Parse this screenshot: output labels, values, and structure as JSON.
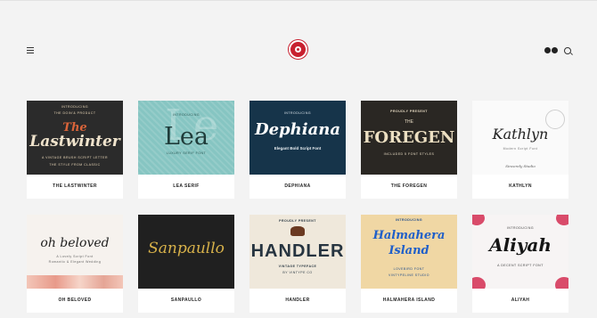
{
  "header": {
    "menu_icon": "hamburger-menu-icon",
    "logo": "brand-logo",
    "social_icons": [
      "dribbble-icon",
      "behance-icon"
    ],
    "search_icon": "search-icon"
  },
  "colors": {
    "background": "#f3f3f3",
    "card": "#ffffff",
    "logo": "#c8202f",
    "text": "#222222"
  },
  "products": [
    {
      "label": "THE LASTWINTER",
      "thumb": {
        "line1": "INTRODUCING",
        "line2": "THE DOIN'& PRODUCT",
        "line3": "A VINTAGE BRUSH SCRIPT LETTER",
        "title1": "The",
        "title2": "Lastwinter",
        "footer": "THE STYLE FROM CLASSIC"
      }
    },
    {
      "label": "LEA SERIF",
      "thumb": {
        "line1": "INTRODUCING",
        "title": "Lea",
        "footer": "LUXURY SERIF FONT"
      }
    },
    {
      "label": "DEPHIANA",
      "thumb": {
        "line1": "INTRODUCING",
        "title": "Dephiana",
        "subtitle": "Elegant Bold Script Font"
      }
    },
    {
      "label": "THE FOREGEN",
      "thumb": {
        "line1": "PROUDLY PRESENT",
        "line2": "THE",
        "title": "FOREGEN",
        "subtitle": "INCLUDED 5 FONT STYLES"
      }
    },
    {
      "label": "KATHLYN",
      "thumb": {
        "title": "Kathlyn",
        "footer": "Modern Script Font",
        "signature": "Sincerely Studio"
      }
    },
    {
      "label": "OH BELOVED",
      "thumb": {
        "title": "oh beloved",
        "subtitle": "A Lovely Script Font",
        "footer": "Romantic & Elegant Wedding"
      }
    },
    {
      "label": "SANPAULLO",
      "thumb": {
        "title": "Sanpaullo"
      }
    },
    {
      "label": "HANDLER",
      "thumb": {
        "line1": "PROUDLY PRESENT",
        "title": "HANDLER",
        "subtitle": "VINTAGE TYPEFACE",
        "footer": "BY VINTYPE CO"
      }
    },
    {
      "label": "HALMAHERA ISLAND",
      "thumb": {
        "line1": "INTRODUCING",
        "title1": "Halmahera",
        "title2": "Island",
        "footer1": "LOVEBIRD FONT",
        "footer2": "VINTYPELINE STUDIO"
      }
    },
    {
      "label": "ALIYAH",
      "thumb": {
        "line1": "INTRODUCING",
        "title": "Aliyah",
        "subtitle": "A DECENT SCRIPT FONT"
      }
    }
  ]
}
